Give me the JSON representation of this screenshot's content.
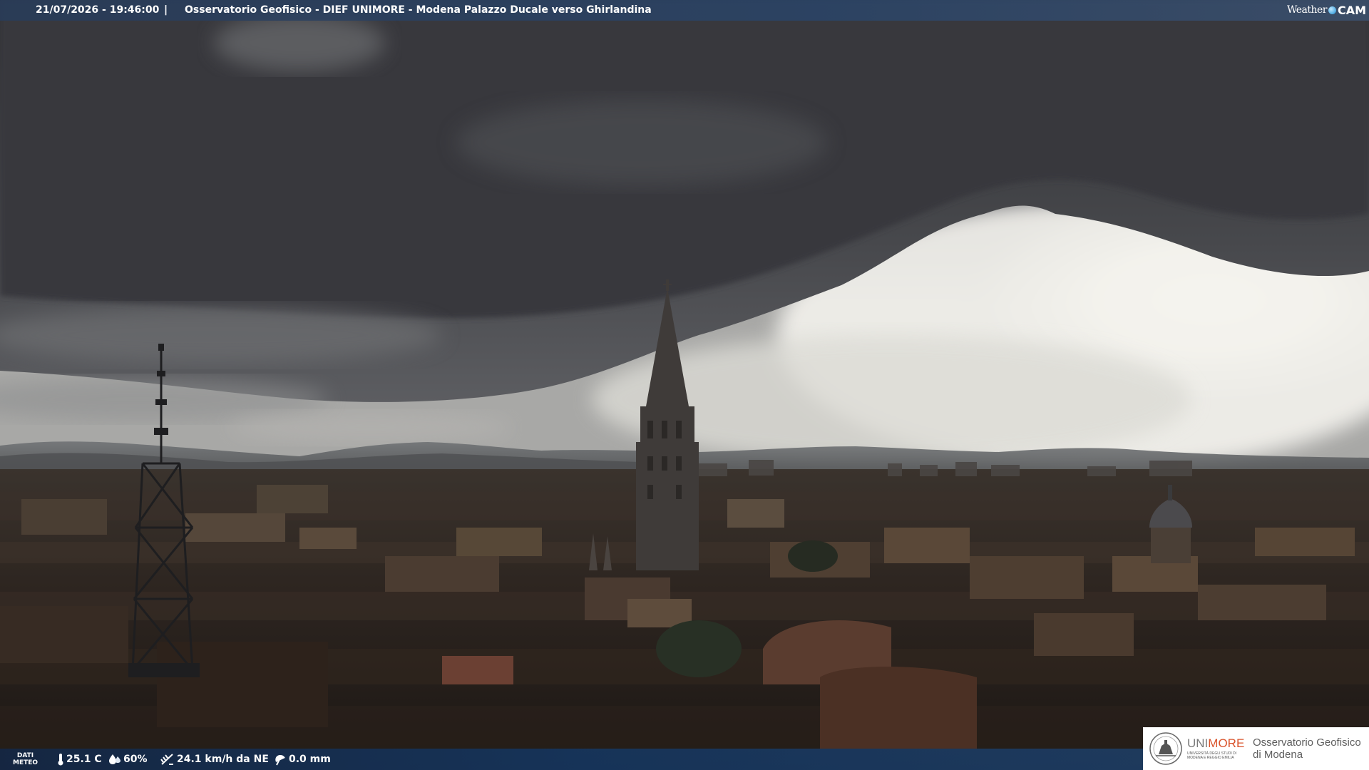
{
  "header": {
    "datetime": "21/07/2026 - 19:46:00",
    "separator": "|",
    "title": "Osservatorio Geofisico - DIEF UNIMORE - Modena Palazzo Ducale verso Ghirlandina",
    "brand_weather": "Weather",
    "brand_cam": "CAM"
  },
  "meteo": {
    "label_line1": "DATI",
    "label_line2": "METEO",
    "temperature": "25.1 C",
    "humidity": "60%",
    "wind": "24.1 km/h da NE",
    "rain": "0.0 mm",
    "icons": [
      "thermometer-icon",
      "humidity-drop-icon",
      "wind-icon",
      "rain-umbrella-icon"
    ]
  },
  "logo": {
    "unimore_uni": "UNI",
    "unimore_more": "MORE",
    "unimore_sub1": "UNIVERSITÀ DEGLI STUDI DI",
    "unimore_sub2": "MODENA E REGGIO EMILIA",
    "osservatorio_line1": "Osservatorio Geofisico",
    "osservatorio_line2": "di Modena"
  },
  "colors": {
    "unimore_accent": "#d9532b",
    "bar_blue": "#1e4a80",
    "brand_dot": "#1b8fd6"
  }
}
